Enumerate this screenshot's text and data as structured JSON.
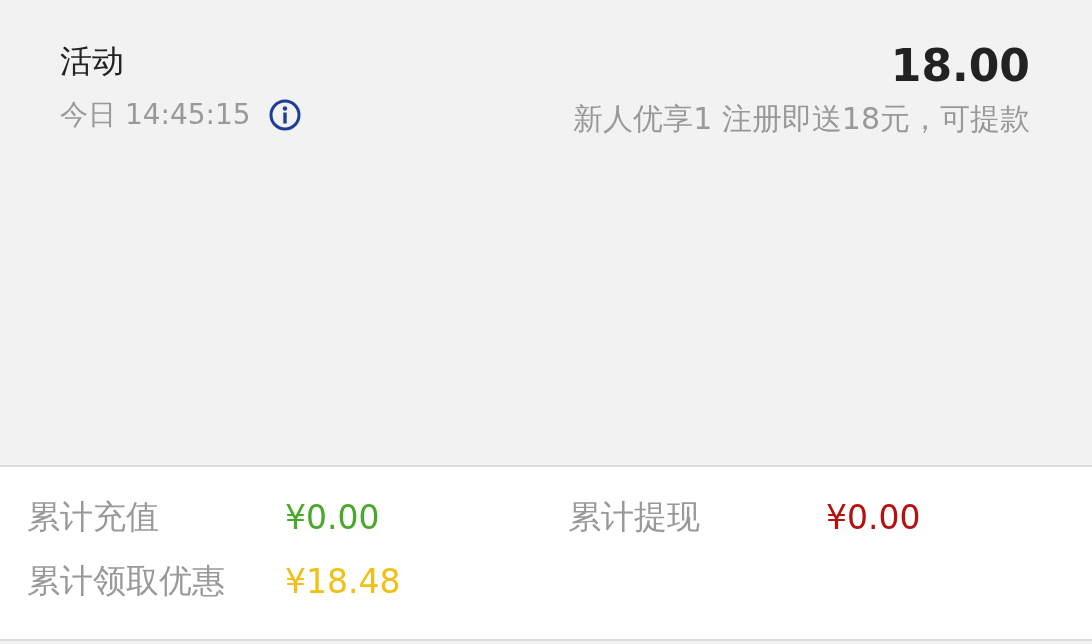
{
  "records": [
    {
      "title": "活动",
      "time": "今日 14:45:15",
      "amount": "18.00",
      "description": "新人优享1 注册即送18元，可提款"
    }
  ],
  "summary": [
    {
      "label": "累计充值",
      "value": "¥0.00",
      "color": "#4aa82a"
    },
    {
      "label": "累计提现",
      "value": "¥0.00",
      "color": "#b80f0f"
    },
    {
      "label": "累计领取优惠",
      "value": "¥18.48",
      "color": "#f2c012"
    }
  ]
}
